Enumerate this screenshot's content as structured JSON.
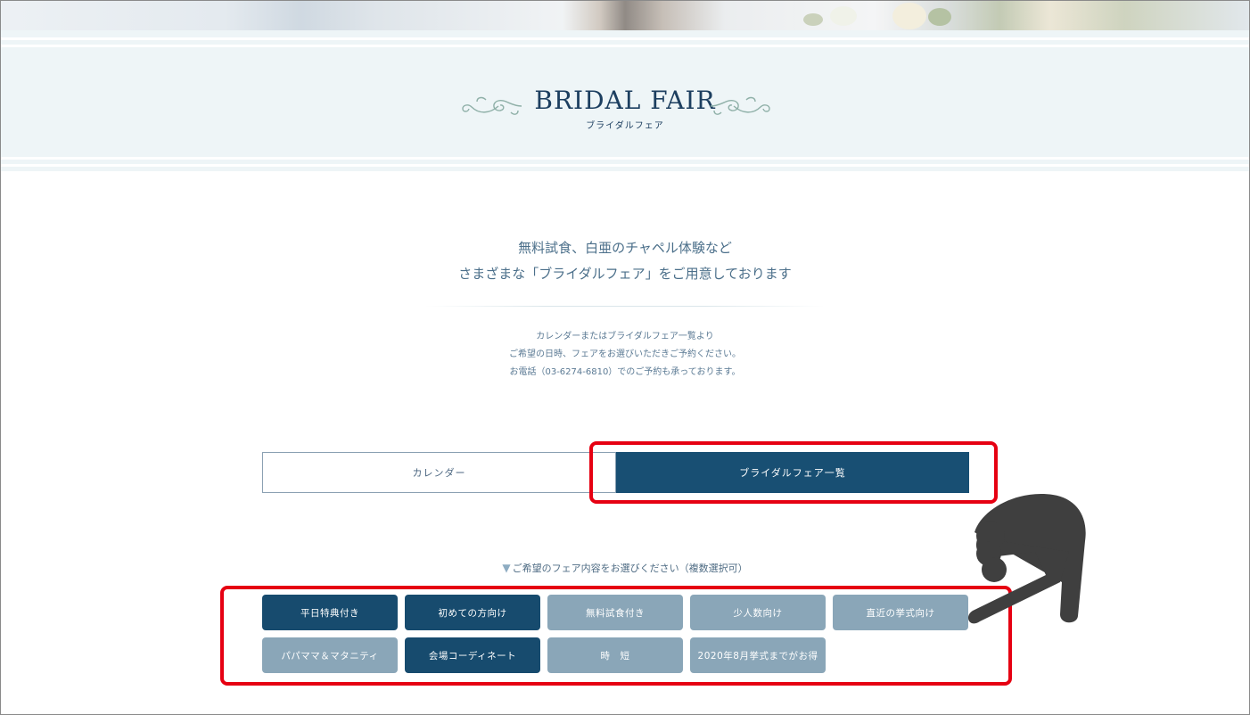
{
  "header": {
    "title": "BRIDAL FAIR",
    "subtitle": "ブライダルフェア"
  },
  "intro": {
    "line1": "無料試食、白亜のチャペル体験など",
    "line2": "さまざまな「ブライダルフェア」をご用意しております"
  },
  "info": {
    "line1": "カレンダーまたはブライダルフェア一覧より",
    "line2": "ご希望の日時、フェアをお選びいただきご予約ください。",
    "line3": "お電話（03-6274-6810）でのご予約も承っております。"
  },
  "tabs": {
    "calendar": "カレンダー",
    "list": "ブライダルフェア一覧",
    "active": "list"
  },
  "filter": {
    "hint": "ご希望のフェア内容をお選びください（複数選択可）",
    "options": [
      {
        "label": "平日特典付き",
        "selected": true
      },
      {
        "label": "初めての方向け",
        "selected": true
      },
      {
        "label": "無料試食付き",
        "selected": false
      },
      {
        "label": "少人数向け",
        "selected": false
      },
      {
        "label": "直近の挙式向け",
        "selected": false
      },
      {
        "label": "パパママ＆マタニティ",
        "selected": false
      },
      {
        "label": "会場コーディネート",
        "selected": true
      },
      {
        "label": "時　短",
        "selected": false
      },
      {
        "label": "2020年8月挙式までがお得",
        "selected": false
      }
    ]
  },
  "colors": {
    "brand_navy": "#174b6e",
    "chip_inactive": "#8aa6b8",
    "hero_background": "#eef5f7",
    "annotation_red": "#e60012",
    "pointer_hand": "#3f3f3f"
  },
  "icons": {
    "ornament": "flourish-ornament",
    "hint_marker": "triangle-down-icon",
    "pointer": "pointing-hand-icon"
  }
}
